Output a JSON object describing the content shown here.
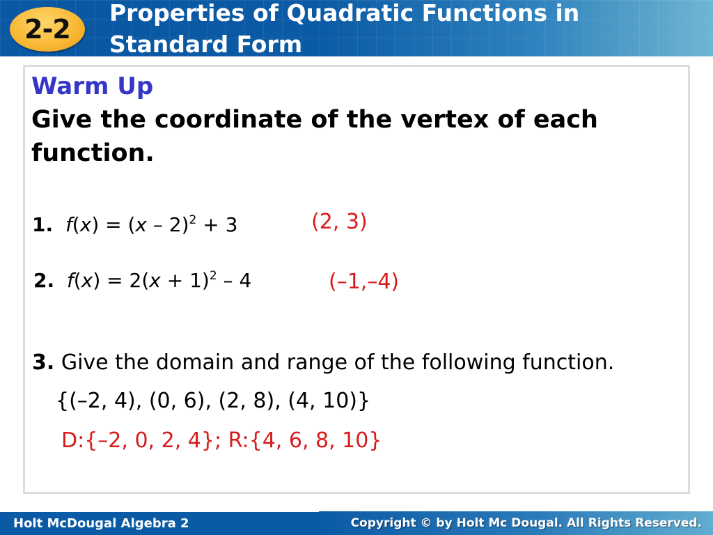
{
  "header": {
    "badge": "2-2",
    "title_line1": "Properties of Quadratic Functions in",
    "title_line2": "Standard Form"
  },
  "content": {
    "heading": "Warm Up",
    "instruction": "Give the coordinate of the vertex of each function.",
    "problems": [
      {
        "number": "1.",
        "f": "f",
        "x_paren_open": "(",
        "x": "x",
        "eq_part1": ") = (",
        "x2": "x",
        "eq_part2": " – 2)",
        "exponent": "2",
        "eq_part3": " + 3",
        "answer": "(2, 3)"
      },
      {
        "number": "2.",
        "f": "f",
        "x_paren_open": "(",
        "x": "x",
        "eq_part1": ") = 2(",
        "x2": "x",
        "eq_part2": " + 1)",
        "exponent": "2",
        "eq_part3": " – 4",
        "answer": "(–1,–4)"
      },
      {
        "number": "3.",
        "text": "Give the domain and range of the following function.",
        "set": "{(–2, 4), (0, 6), (2, 8), (4, 10)}",
        "answer": "D:{–2, 0, 2, 4}; R:{4, 6, 8, 10}"
      }
    ]
  },
  "footer": {
    "left": "Holt McDougal Algebra 2",
    "right": "Copyright © by Holt Mc Dougal. All Rights Reserved."
  },
  "colors": {
    "header_blue": "#0b5aa5",
    "badge_yellow": "#f8b733",
    "heading_blue": "#3535c8",
    "answer_red": "#d81b1b"
  }
}
